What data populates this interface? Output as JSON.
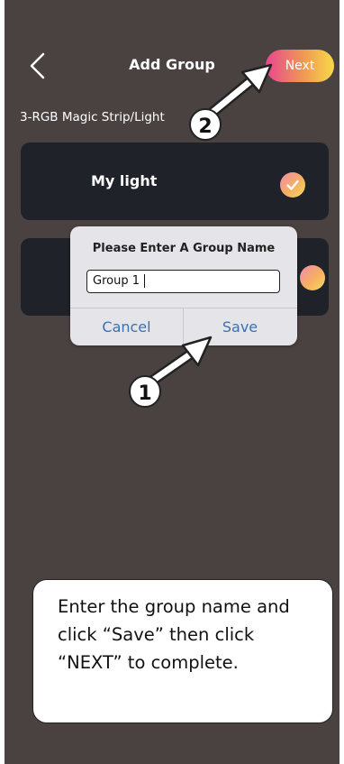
{
  "header": {
    "title": "Add Group",
    "next_label": "Next"
  },
  "device_type": "3-RGB Magic Strip/Light",
  "lights": [
    {
      "label": "My light",
      "selected": true
    },
    {
      "label": "",
      "selected": true
    }
  ],
  "dialog": {
    "title": "Please Enter A Group Name",
    "input_value": "Group 1",
    "cancel_label": "Cancel",
    "save_label": "Save"
  },
  "annotations": {
    "step_1": "1",
    "step_2": "2",
    "instruction": "Enter the group name and click “Save” then click “NEXT” to complete."
  },
  "colors": {
    "background": "#4a4241",
    "card": "#20222a",
    "accent_start": "#e8468f",
    "accent_end": "#f8d84a",
    "dialog_button_text": "#3a72b0"
  }
}
